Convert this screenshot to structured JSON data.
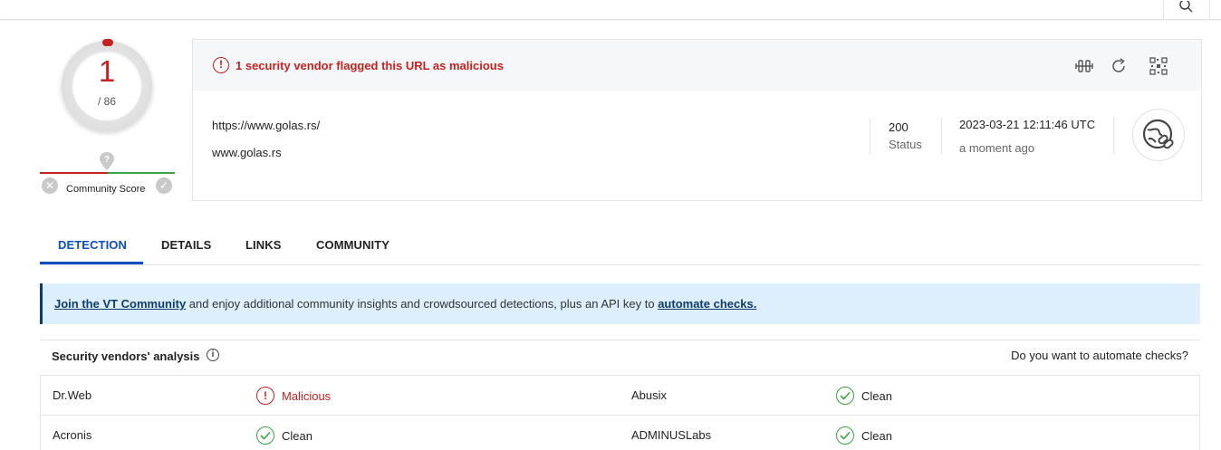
{
  "score": {
    "detections": "1",
    "total": "/ 86",
    "color": "#c5221f"
  },
  "community": {
    "label": "Community Score"
  },
  "alert": {
    "text": "1 security vendor flagged this URL as malicious"
  },
  "resource": {
    "url": "https://www.golas.rs/",
    "host": "www.golas.rs",
    "status_code": "200",
    "status_label": "Status",
    "date": "2023-03-21 12:11:46 UTC",
    "ago": "a moment ago"
  },
  "tabs": [
    {
      "label": "DETECTION",
      "active": true
    },
    {
      "label": "DETAILS"
    },
    {
      "label": "LINKS"
    },
    {
      "label": "COMMUNITY"
    }
  ],
  "banner": {
    "link1": "Join the VT Community",
    "middle": " and enjoy additional community insights and crowdsourced detections, plus an API key to ",
    "link2": "automate checks."
  },
  "analysis": {
    "title": "Security vendors' analysis",
    "automate_text": "Do you want to automate checks?"
  },
  "vendors": [
    {
      "name": "Dr.Web",
      "result": "Malicious",
      "name2": "Abusix",
      "result2": "Clean"
    },
    {
      "name": "Acronis",
      "result": "Clean",
      "name2": "ADMINUSLabs",
      "result2": "Clean"
    }
  ],
  "icons": [
    "search-icon",
    "alert-icon",
    "compare-icon",
    "reanalyze-icon",
    "qr-code-icon",
    "globe-link-icon",
    "question-pin-icon",
    "close-icon",
    "check-icon",
    "info-icon"
  ]
}
